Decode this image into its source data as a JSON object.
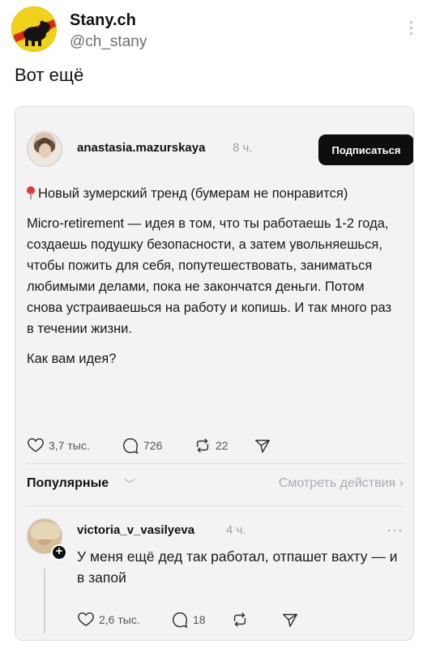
{
  "post": {
    "author_name": "Stany.ch",
    "author_handle": "@ch_stany",
    "text": "Вот ещё",
    "avatar_icon": "bear-coat-of-arms-icon",
    "more_icon": "more-vertical-icon"
  },
  "thread": {
    "main": {
      "username": "anastasia.mazurskaya",
      "time": "8 ч.",
      "follow_label": "Подписаться",
      "pin_icon": "pushpin-icon",
      "title": "Новый зумерский тренд (бумерам не понравится)",
      "body": "Micro-retirement — идея в том, что ты работаешь 1-2 года, создаешь подушку безопасности, а затем увольняешься, чтобы пожить для себя, попутешествовать, заниматься любимыми делами, пока не закончатся деньги. Потом снова устраиваешься на работу и копишь. И так много раз в течении жизни.",
      "question": "Как вам идея?",
      "likes": "3,7 тыс.",
      "comments": "726",
      "reposts": "22",
      "send_icon": "send-icon"
    },
    "tabs": {
      "popular": "Популярные",
      "popular_chevron": "﹀",
      "view_actions": "Смотреть действия ›"
    },
    "reply": {
      "username": "victoria_v_vasilyeva",
      "time": "4 ч.",
      "more": "···",
      "text": "У меня ещё дед так работал, отпашет вахту — и в запой",
      "likes": "2,6 тыс.",
      "comments": "18"
    }
  },
  "colors": {
    "avatar_yellow": "#f1d21a",
    "follow_button_bg": "#0e0e10",
    "muted_text": "#a0a3a8",
    "card_bg": "#f3f3f4"
  }
}
